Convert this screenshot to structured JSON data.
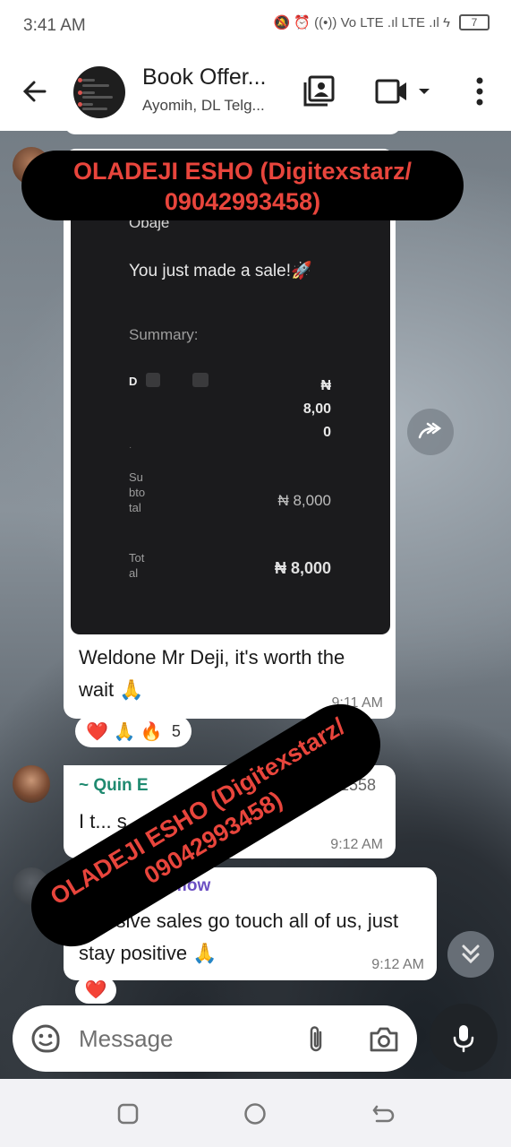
{
  "status_bar": {
    "time": "3:41 AM",
    "indicators": "🔕 ⏰ ((•)) Vo LTE .ıl LTE .ıl ϟ",
    "battery": "7"
  },
  "header": {
    "title": "Book Offer...",
    "subtitle": "Ayomih, DL Telg..."
  },
  "receipt": {
    "name": "Obaje",
    "sale_text": "You just made a sale!🚀",
    "summary_label": "Summary:",
    "item_initial": "D",
    "item_amount": "₦\n8,00\n0",
    "dot": "·",
    "subtotal_label": "Subtotal",
    "subtotal_value": "₦ 8,000",
    "total_label": "Total",
    "total_value": "₦ 8,000"
  },
  "messages": [
    {
      "text": "Weldone Mr Deji, it's worth the wait 🙏",
      "time": "9:11 AM",
      "reactions": "❤️ 🙏 🔥",
      "reaction_count": "5"
    },
    {
      "sender": "~ Quin E",
      "phone": "+234 906 170 1558",
      "text": "I t... s.... ijn 🙏🏻",
      "time": "9:12 AM"
    },
    {
      "sender": "~ Client cartflow",
      "text": "Massive sales go touch all of us, just stay positive 🙏",
      "time": "9:12 AM",
      "reaction": "❤️"
    }
  ],
  "watermark": {
    "text_top": "OLADEJI ESHO (Digitexstarz/ 09042993458)",
    "text_diag": "OLADEJI ESHO (Digitexstarz/ 09042993458)",
    "color": "#e8453c"
  },
  "composer": {
    "placeholder": "Message"
  },
  "icons": {
    "back": "back-arrow-icon",
    "contacts": "contact-card-icon",
    "video": "video-camera-icon",
    "more": "more-vertical-icon",
    "forward": "forward-icon",
    "scroll": "double-chevron-down-icon",
    "sticker": "sticker-icon",
    "attach": "paperclip-icon",
    "camera": "camera-icon",
    "mic": "microphone-icon"
  }
}
